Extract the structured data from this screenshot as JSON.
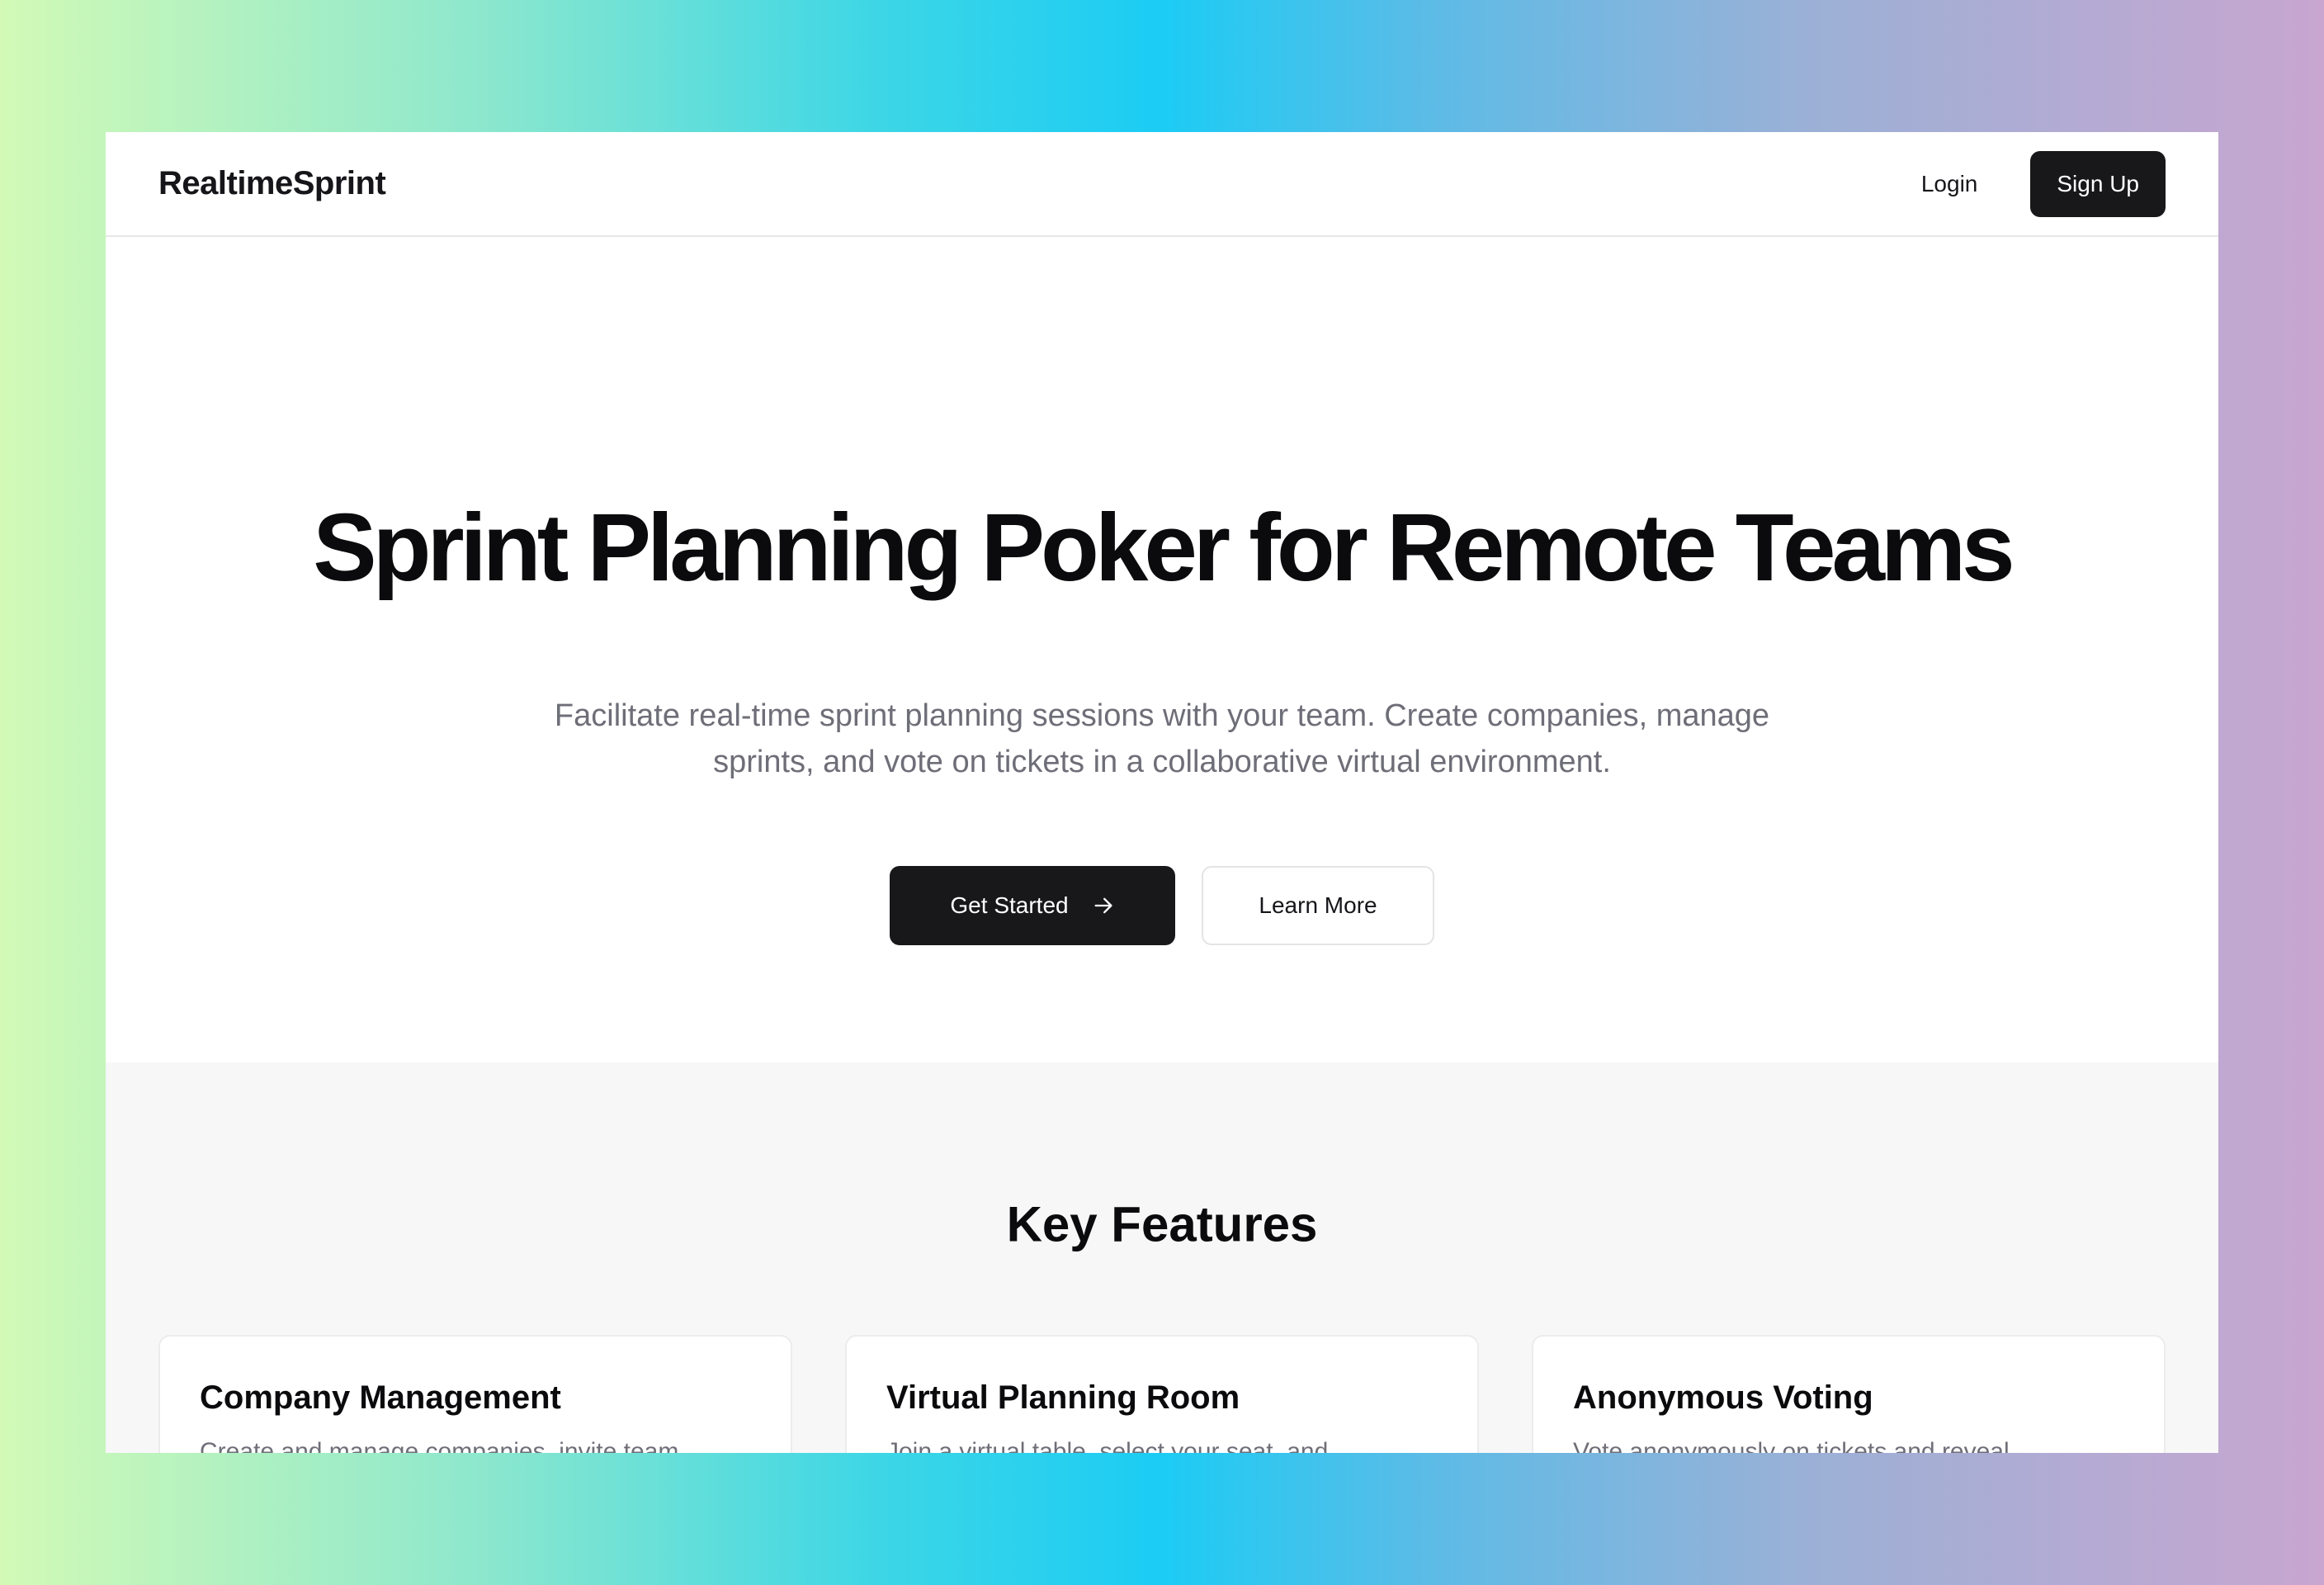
{
  "nav": {
    "brand": "RealtimeSprint",
    "login_label": "Login",
    "signup_label": "Sign Up"
  },
  "hero": {
    "title": "Sprint Planning Poker for Remote Teams",
    "subtitle": "Facilitate real-time sprint planning sessions with your team. Create companies, manage sprints, and vote on tickets in a collaborative virtual environment.",
    "primary_label": "Get Started",
    "primary_icon": "arrow-right-icon",
    "secondary_label": "Learn More"
  },
  "features": {
    "title": "Key Features",
    "cards": [
      {
        "title": "Company Management",
        "description": "Create and manage companies, invite team"
      },
      {
        "title": "Virtual Planning Room",
        "description": "Join a virtual table, select your seat, and"
      },
      {
        "title": "Anonymous Voting",
        "description": "Vote anonymously on tickets and reveal"
      }
    ]
  }
}
